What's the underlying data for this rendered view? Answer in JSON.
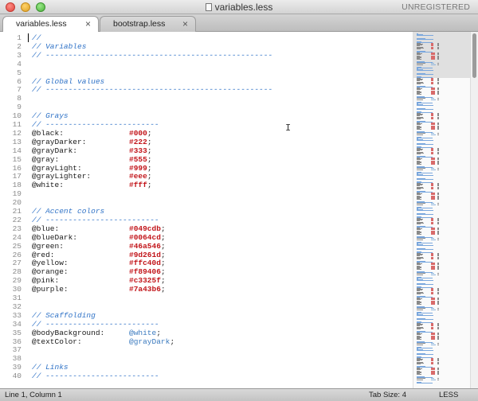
{
  "window": {
    "title": "variables.less",
    "registration": "UNREGISTERED"
  },
  "tabs": [
    {
      "label": "variables.less",
      "active": true,
      "close_glyph": "×"
    },
    {
      "label": "bootstrap.less",
      "active": false,
      "close_glyph": "×"
    }
  ],
  "editor": {
    "lines": [
      {
        "n": "1",
        "tokens": [
          {
            "t": "comment",
            "v": "//"
          }
        ]
      },
      {
        "n": "2",
        "tokens": [
          {
            "t": "comment",
            "v": "// Variables"
          }
        ]
      },
      {
        "n": "3",
        "tokens": [
          {
            "t": "comment",
            "v": "// --------------------------------------------------"
          }
        ]
      },
      {
        "n": "4",
        "tokens": []
      },
      {
        "n": "5",
        "tokens": []
      },
      {
        "n": "6",
        "tokens": [
          {
            "t": "comment",
            "v": "// Global values"
          }
        ]
      },
      {
        "n": "7",
        "tokens": [
          {
            "t": "comment",
            "v": "// --------------------------------------------------"
          }
        ]
      },
      {
        "n": "8",
        "tokens": []
      },
      {
        "n": "9",
        "tokens": []
      },
      {
        "n": "10",
        "tokens": [
          {
            "t": "comment",
            "v": "// Grays"
          }
        ]
      },
      {
        "n": "11",
        "tokens": [
          {
            "t": "comment",
            "v": "// -------------------------"
          }
        ]
      },
      {
        "n": "12",
        "tokens": [
          {
            "t": "var",
            "v": "@black:"
          },
          {
            "t": "hex",
            "v": "#000"
          },
          {
            "t": "punct",
            "v": ";"
          }
        ]
      },
      {
        "n": "13",
        "tokens": [
          {
            "t": "var",
            "v": "@grayDarker:"
          },
          {
            "t": "hex",
            "v": "#222"
          },
          {
            "t": "punct",
            "v": ";"
          }
        ]
      },
      {
        "n": "14",
        "tokens": [
          {
            "t": "var",
            "v": "@grayDark:"
          },
          {
            "t": "hex",
            "v": "#333"
          },
          {
            "t": "punct",
            "v": ";"
          }
        ]
      },
      {
        "n": "15",
        "tokens": [
          {
            "t": "var",
            "v": "@gray:"
          },
          {
            "t": "hex",
            "v": "#555"
          },
          {
            "t": "punct",
            "v": ";"
          }
        ]
      },
      {
        "n": "16",
        "tokens": [
          {
            "t": "var",
            "v": "@grayLight:"
          },
          {
            "t": "hex",
            "v": "#999"
          },
          {
            "t": "punct",
            "v": ";"
          }
        ]
      },
      {
        "n": "17",
        "tokens": [
          {
            "t": "var",
            "v": "@grayLighter:"
          },
          {
            "t": "hex",
            "v": "#eee"
          },
          {
            "t": "punct",
            "v": ";"
          }
        ]
      },
      {
        "n": "18",
        "tokens": [
          {
            "t": "var",
            "v": "@white:"
          },
          {
            "t": "hex",
            "v": "#fff"
          },
          {
            "t": "punct",
            "v": ";"
          }
        ]
      },
      {
        "n": "19",
        "tokens": []
      },
      {
        "n": "20",
        "tokens": []
      },
      {
        "n": "21",
        "tokens": [
          {
            "t": "comment",
            "v": "// Accent colors"
          }
        ]
      },
      {
        "n": "22",
        "tokens": [
          {
            "t": "comment",
            "v": "// -------------------------"
          }
        ]
      },
      {
        "n": "23",
        "tokens": [
          {
            "t": "var",
            "v": "@blue:"
          },
          {
            "t": "hex",
            "v": "#049cdb"
          },
          {
            "t": "punct",
            "v": ";"
          }
        ]
      },
      {
        "n": "24",
        "tokens": [
          {
            "t": "var",
            "v": "@blueDark:"
          },
          {
            "t": "hex",
            "v": "#0064cd"
          },
          {
            "t": "punct",
            "v": ";"
          }
        ]
      },
      {
        "n": "25",
        "tokens": [
          {
            "t": "var",
            "v": "@green:"
          },
          {
            "t": "hex",
            "v": "#46a546"
          },
          {
            "t": "punct",
            "v": ";"
          }
        ]
      },
      {
        "n": "26",
        "tokens": [
          {
            "t": "var",
            "v": "@red:"
          },
          {
            "t": "hex",
            "v": "#9d261d"
          },
          {
            "t": "punct",
            "v": ";"
          }
        ]
      },
      {
        "n": "27",
        "tokens": [
          {
            "t": "var",
            "v": "@yellow:"
          },
          {
            "t": "hex",
            "v": "#ffc40d"
          },
          {
            "t": "punct",
            "v": ";"
          }
        ]
      },
      {
        "n": "28",
        "tokens": [
          {
            "t": "var",
            "v": "@orange:"
          },
          {
            "t": "hex",
            "v": "#f89406"
          },
          {
            "t": "punct",
            "v": ";"
          }
        ]
      },
      {
        "n": "29",
        "tokens": [
          {
            "t": "var",
            "v": "@pink:"
          },
          {
            "t": "hex",
            "v": "#c3325f"
          },
          {
            "t": "punct",
            "v": ";"
          }
        ]
      },
      {
        "n": "30",
        "tokens": [
          {
            "t": "var",
            "v": "@purple:"
          },
          {
            "t": "hex",
            "v": "#7a43b6"
          },
          {
            "t": "punct",
            "v": ";"
          }
        ]
      },
      {
        "n": "31",
        "tokens": []
      },
      {
        "n": "32",
        "tokens": []
      },
      {
        "n": "33",
        "tokens": [
          {
            "t": "comment",
            "v": "// Scaffolding"
          }
        ]
      },
      {
        "n": "34",
        "tokens": [
          {
            "t": "comment",
            "v": "// -------------------------"
          }
        ]
      },
      {
        "n": "35",
        "tokens": [
          {
            "t": "var",
            "v": "@bodyBackground:"
          },
          {
            "t": "ref",
            "v": "@white"
          },
          {
            "t": "punct",
            "v": ";"
          }
        ]
      },
      {
        "n": "36",
        "tokens": [
          {
            "t": "var",
            "v": "@textColor:"
          },
          {
            "t": "ref",
            "v": "@grayDark"
          },
          {
            "t": "punct",
            "v": ";"
          }
        ]
      },
      {
        "n": "37",
        "tokens": []
      },
      {
        "n": "38",
        "tokens": []
      },
      {
        "n": "39",
        "tokens": [
          {
            "t": "comment",
            "v": "// Links"
          }
        ]
      },
      {
        "n": "40",
        "tokens": [
          {
            "t": "comment",
            "v": "// -------------------------"
          }
        ]
      }
    ]
  },
  "status": {
    "position": "Line 1, Column 1",
    "tab_size": "Tab Size: 4",
    "syntax": "LESS"
  },
  "colors": {
    "comment": "#3073c7",
    "hex_value": "#c2151a",
    "reference": "#3c7bbf",
    "line_number": "#8a8a8a"
  },
  "icons": {
    "cursor": "i-beam-icon",
    "tab_close": "close-icon",
    "document": "document-icon"
  }
}
